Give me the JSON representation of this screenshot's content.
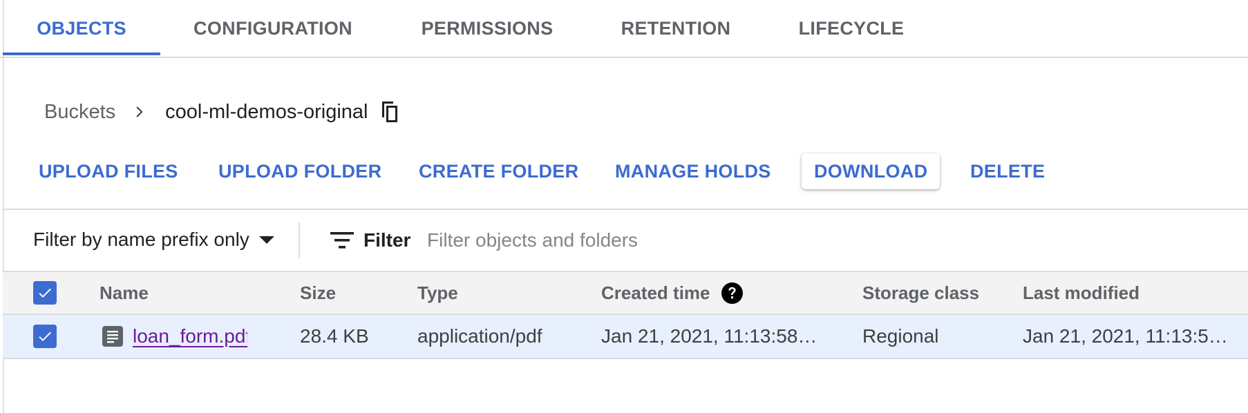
{
  "tabs": [
    {
      "label": "OBJECTS",
      "active": true
    },
    {
      "label": "CONFIGURATION",
      "active": false
    },
    {
      "label": "PERMISSIONS",
      "active": false
    },
    {
      "label": "RETENTION",
      "active": false
    },
    {
      "label": "LIFECYCLE",
      "active": false
    }
  ],
  "breadcrumb": {
    "root": "Buckets",
    "current": "cool-ml-demos-original",
    "separator_icon": "chevron-right-icon",
    "copy_icon": "copy-icon"
  },
  "actions": [
    {
      "label": "UPLOAD FILES"
    },
    {
      "label": "UPLOAD FOLDER"
    },
    {
      "label": "CREATE FOLDER"
    },
    {
      "label": "MANAGE HOLDS"
    },
    {
      "label": "DOWNLOAD",
      "raised": true
    },
    {
      "label": "DELETE"
    }
  ],
  "filter": {
    "mode_label": "Filter by name prefix only",
    "button_label": "Filter",
    "placeholder": "Filter objects and folders",
    "value": ""
  },
  "table": {
    "columns": [
      "Name",
      "Size",
      "Type",
      "Created time",
      "Storage class",
      "Last modified"
    ],
    "header_checked": true,
    "rows": [
      {
        "checked": true,
        "name": "loan_form.pdf",
        "size": "28.4 KB",
        "type": "application/pdf",
        "created": "Jan 21, 2021, 11:13:58…",
        "storage_class": "Regional",
        "last_modified": "Jan 21, 2021, 11:13:5…"
      }
    ]
  },
  "colors": {
    "accent": "#3c6bd1",
    "row_selected": "#e8f0fe",
    "header_bg": "#f3f3f3",
    "link_visited": "#6a1b9a"
  }
}
